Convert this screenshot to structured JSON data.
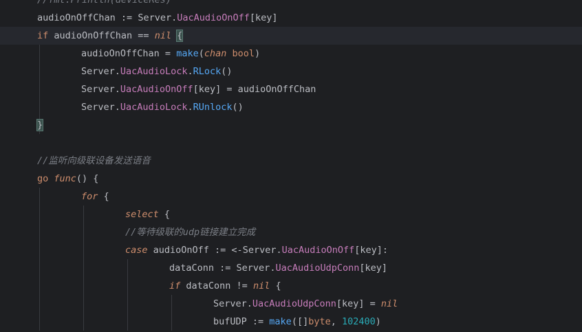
{
  "editor": {
    "lines": [
      {
        "indent": 0,
        "tokens": [
          {
            "t": "//fmt.Println(deviceRes)",
            "c": "tok-cm"
          }
        ]
      },
      {
        "indent": 0,
        "tokens": [
          {
            "t": "audioOnOffChan",
            "c": "tok-var"
          },
          {
            "t": " := ",
            "c": "tok-var"
          },
          {
            "t": "Server",
            "c": "tok-var"
          },
          {
            "t": ".",
            "c": "tok-var"
          },
          {
            "t": "UacAudioOnOff",
            "c": "tok-fld"
          },
          {
            "t": "[key]",
            "c": "tok-var"
          }
        ]
      },
      {
        "indent": 0,
        "current": true,
        "tokens": [
          {
            "t": "if",
            "c": "tok-kw"
          },
          {
            "t": " audioOnOffChan == ",
            "c": "tok-var"
          },
          {
            "t": "nil",
            "c": "tok-kwi"
          },
          {
            "t": " ",
            "c": "tok-var"
          },
          {
            "t": "{",
            "c": "brace-hl"
          }
        ]
      },
      {
        "indent": 1,
        "tokens": [
          {
            "t": "audioOnOffChan",
            "c": "tok-var"
          },
          {
            "t": " = ",
            "c": "tok-var"
          },
          {
            "t": "make",
            "c": "tok-fn"
          },
          {
            "t": "(",
            "c": "tok-var"
          },
          {
            "t": "chan",
            "c": "tok-kwi"
          },
          {
            "t": " ",
            "c": "tok-var"
          },
          {
            "t": "bool",
            "c": "tok-ty"
          },
          {
            "t": ")",
            "c": "tok-var"
          }
        ]
      },
      {
        "indent": 1,
        "tokens": [
          {
            "t": "Server",
            "c": "tok-var"
          },
          {
            "t": ".",
            "c": "tok-var"
          },
          {
            "t": "UacAudioLock",
            "c": "tok-fld"
          },
          {
            "t": ".",
            "c": "tok-var"
          },
          {
            "t": "RLock",
            "c": "tok-fn"
          },
          {
            "t": "()",
            "c": "tok-var"
          }
        ]
      },
      {
        "indent": 1,
        "tokens": [
          {
            "t": "Server",
            "c": "tok-var"
          },
          {
            "t": ".",
            "c": "tok-var"
          },
          {
            "t": "UacAudioOnOff",
            "c": "tok-fld"
          },
          {
            "t": "[key] = audioOnOffChan",
            "c": "tok-var"
          }
        ]
      },
      {
        "indent": 1,
        "tokens": [
          {
            "t": "Server",
            "c": "tok-var"
          },
          {
            "t": ".",
            "c": "tok-var"
          },
          {
            "t": "UacAudioLock",
            "c": "tok-fld"
          },
          {
            "t": ".",
            "c": "tok-var"
          },
          {
            "t": "RUnlock",
            "c": "tok-fn"
          },
          {
            "t": "()",
            "c": "tok-var"
          }
        ]
      },
      {
        "indent": 0,
        "tokens": [
          {
            "t": "}",
            "c": "brace-hl"
          }
        ]
      },
      {
        "indent": 0,
        "tokens": []
      },
      {
        "indent": 0,
        "tokens": [
          {
            "t": "//监听向级联设备发送语音",
            "c": "tok-cm"
          }
        ]
      },
      {
        "indent": 0,
        "tokens": [
          {
            "t": "go",
            "c": "tok-kw"
          },
          {
            "t": " ",
            "c": "tok-var"
          },
          {
            "t": "func",
            "c": "tok-kwi"
          },
          {
            "t": "() {",
            "c": "tok-var"
          }
        ]
      },
      {
        "indent": 1,
        "tokens": [
          {
            "t": "for",
            "c": "tok-kwi"
          },
          {
            "t": " {",
            "c": "tok-var"
          }
        ]
      },
      {
        "indent": 2,
        "tokens": [
          {
            "t": "select",
            "c": "tok-kwi"
          },
          {
            "t": " {",
            "c": "tok-var"
          }
        ]
      },
      {
        "indent": 2,
        "tokens": [
          {
            "t": "//等待级联的udp链接建立完成",
            "c": "tok-cm"
          }
        ]
      },
      {
        "indent": 2,
        "tokens": [
          {
            "t": "case",
            "c": "tok-kwi"
          },
          {
            "t": " audioOnOff := <-",
            "c": "tok-var"
          },
          {
            "t": "Server",
            "c": "tok-var"
          },
          {
            "t": ".",
            "c": "tok-var"
          },
          {
            "t": "UacAudioOnOff",
            "c": "tok-fld"
          },
          {
            "t": "[key]:",
            "c": "tok-var"
          }
        ]
      },
      {
        "indent": 3,
        "tokens": [
          {
            "t": "dataConn",
            "c": "tok-var"
          },
          {
            "t": " := ",
            "c": "tok-var"
          },
          {
            "t": "Server",
            "c": "tok-var"
          },
          {
            "t": ".",
            "c": "tok-var"
          },
          {
            "t": "UacAudioUdpConn",
            "c": "tok-fld"
          },
          {
            "t": "[key]",
            "c": "tok-var"
          }
        ]
      },
      {
        "indent": 3,
        "tokens": [
          {
            "t": "if",
            "c": "tok-kwi"
          },
          {
            "t": " dataConn != ",
            "c": "tok-var"
          },
          {
            "t": "nil",
            "c": "tok-kwi"
          },
          {
            "t": " {",
            "c": "tok-var"
          }
        ]
      },
      {
        "indent": 4,
        "tokens": [
          {
            "t": "Server",
            "c": "tok-var"
          },
          {
            "t": ".",
            "c": "tok-var"
          },
          {
            "t": "UacAudioUdpConn",
            "c": "tok-fld"
          },
          {
            "t": "[key] = ",
            "c": "tok-var"
          },
          {
            "t": "nil",
            "c": "tok-kwi"
          }
        ]
      },
      {
        "indent": 4,
        "tokens": [
          {
            "t": "bufUDP",
            "c": "tok-var"
          },
          {
            "t": " := ",
            "c": "tok-var"
          },
          {
            "t": "make",
            "c": "tok-fn"
          },
          {
            "t": "([]",
            "c": "tok-var"
          },
          {
            "t": "byte",
            "c": "tok-ty"
          },
          {
            "t": ", ",
            "c": "tok-var"
          },
          {
            "t": "102400",
            "c": "tok-num"
          },
          {
            "t": ")",
            "c": "tok-var"
          }
        ]
      }
    ]
  }
}
